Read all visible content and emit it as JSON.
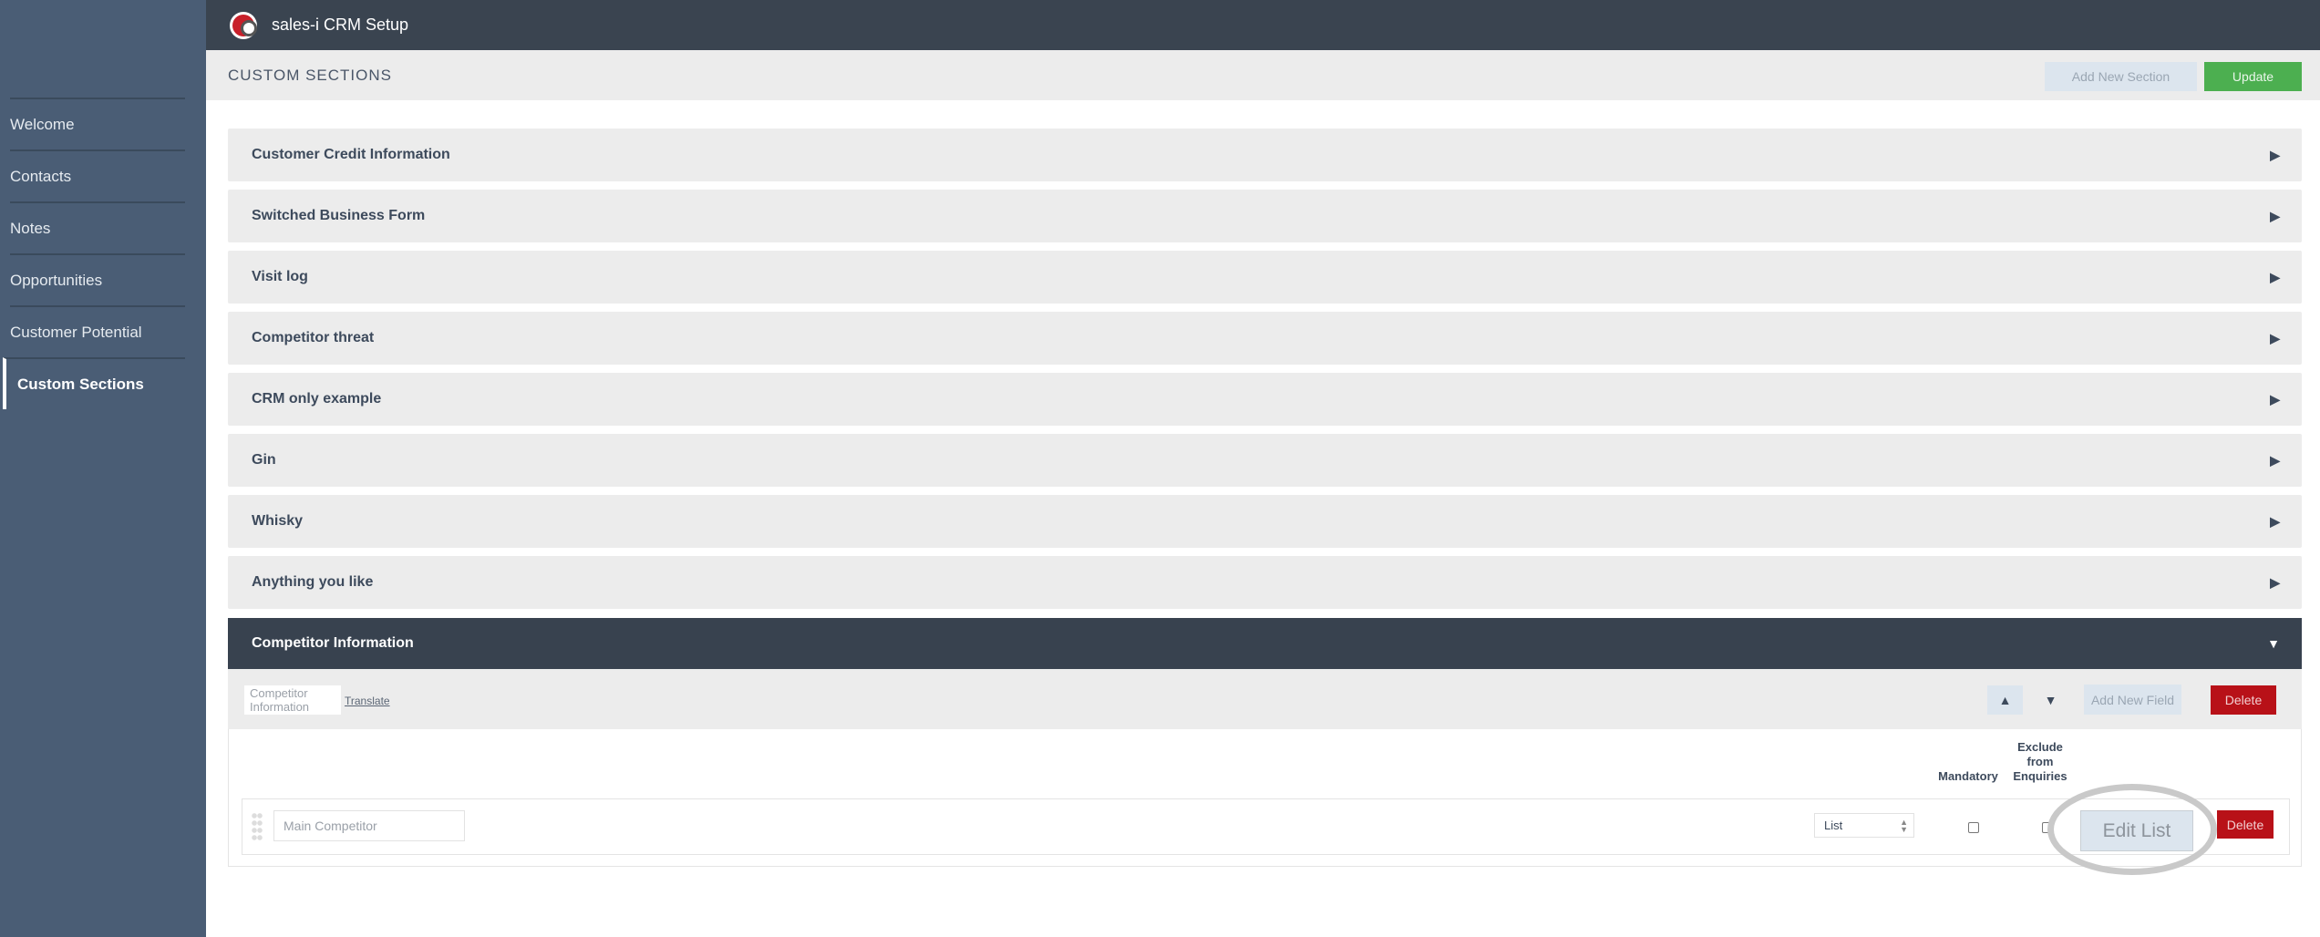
{
  "app": {
    "title": "sales-i CRM Setup",
    "logo_icon": "sales-i-logo"
  },
  "sidebar": {
    "items": [
      {
        "label": "Welcome"
      },
      {
        "label": "Contacts"
      },
      {
        "label": "Notes"
      },
      {
        "label": "Opportunities"
      },
      {
        "label": "Customer Potential"
      },
      {
        "label": "Custom Sections",
        "active": true
      }
    ]
  },
  "page": {
    "title": "CUSTOM SECTIONS",
    "add_section_label": "Add New Section",
    "update_label": "Update"
  },
  "sections": [
    {
      "label": "Customer Credit Information"
    },
    {
      "label": "Switched Business Form"
    },
    {
      "label": "Visit log"
    },
    {
      "label": "Competitor threat"
    },
    {
      "label": "CRM only example"
    },
    {
      "label": "Gin"
    },
    {
      "label": "Whisky"
    },
    {
      "label": "Anything you like"
    }
  ],
  "open_section": {
    "label": "Competitor Information",
    "name_value": "Competitor Information",
    "translate_label": "Translate",
    "move_up": "▲",
    "move_down": "▼",
    "add_field_label": "Add New Field",
    "delete_label": "Delete",
    "columns": {
      "mandatory": "Mandatory",
      "exclude": "Exclude from Enquiries"
    },
    "fields": [
      {
        "name": "Main Competitor",
        "type": "List",
        "mandatory": false,
        "exclude": false,
        "edit_label": "Edit List",
        "delete_label": "Delete"
      }
    ]
  },
  "colors": {
    "sidebar": "#4a5d75",
    "topbar": "#3a4450",
    "accent_green": "#4caf50",
    "danger": "#b81118"
  }
}
